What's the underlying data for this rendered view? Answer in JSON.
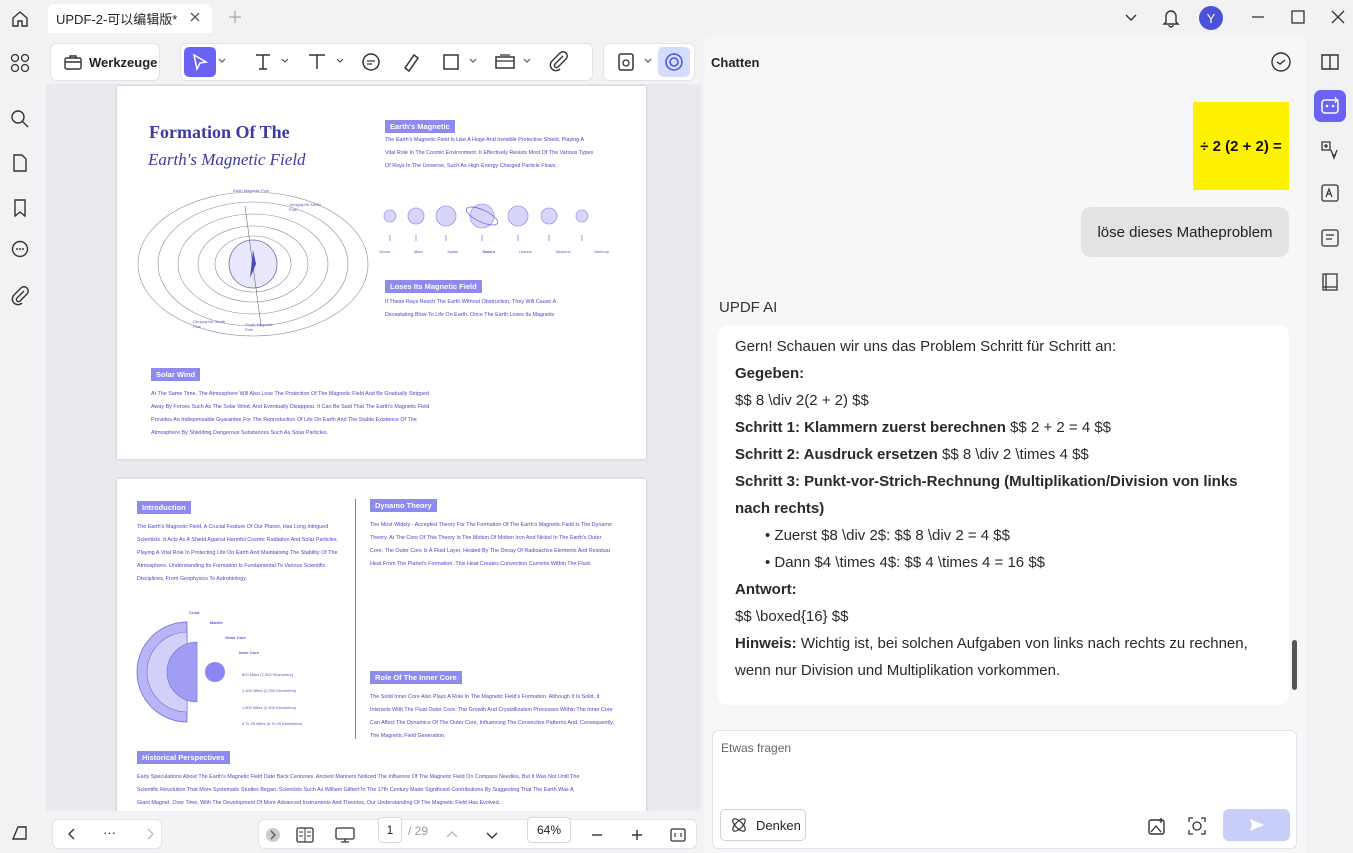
{
  "window": {
    "tab_title": "UPDF-2-可以编辑版*",
    "avatar_letter": "Y"
  },
  "toolbar": {
    "werkzeuge_label": "Werkzeuge"
  },
  "page1": {
    "title_line1": "Formation Of The",
    "title_line2": "Earth's Magnetic Field",
    "section1_label": "Earth's Magnetic",
    "section1_text": "The Earth's Magnetic Field Is Like A Huge And Invisible Protective Shield, Playing A Vital Role In The Cosmic Environment. It Effectively Resists Most Of The Various Types Of Rays In The Universe, Such As High-Energy Charged Particle Flows.",
    "planets": [
      "Venus",
      "Mars",
      "Jupiter",
      "Saturn",
      "Uranus",
      "Neptune",
      "Mercury"
    ],
    "section2_label": "Loses Its Magnetic Field",
    "section2_text": "If These Rays Reach The Earth Without Obstruction, They Will Cause A Devastating Blow To Life On Earth. Once The Earth Loses Its Magnetic",
    "section3_label": "Solar Wind",
    "section3_text": "At The Same Time, The Atmosphere Will Also Lose The Protection Of The Magnetic Field And Be Gradually Stripped Away By Forces Such As The Solar Wind, And Eventually Disappear. It Can Be Said That The Earth's Magnetic Field Provides An Indispensable Guarantee For The Reproduction Of Life On Earth And The Stable Existence Of The Atmosphere By Shielding Dangerous Substances Such As Solar Particles.",
    "diagram_labels": {
      "earth_mag_pole": "Earth Magnetic Pole",
      "geo_north": "Geographic North Pole",
      "geo_south": "Geographic South Pole",
      "south_mag": "South Magnetic Pole"
    }
  },
  "page2": {
    "intro_label": "Introduction",
    "intro_text": "The Earth's Magnetic Field, A Crucial Feature Of Our Planet, Has Long Intrigued Scientists. It Acts As A Shield Against Harmful Cosmic Radiation And Solar Particles, Playing A Vital Role In Protecting Life On Earth And Maintaining The Stability Of The Atmosphere. Understanding Its Formation Is Fundamental To Various Scientific Disciplines, From Geophysics To Astrobiology.",
    "dynamo_label": "Dynamo Theory",
    "dynamo_text": "The Most Widely - Accepted Theory For The Formation Of The Earth's Magnetic Field Is The Dynamo Theory. At The Core Of This Theory Is The Motion Of Molten Iron And Nickel In The Earth's Outer Core. The Outer Core Is A Fluid Layer, Heated By The Decay Of Radioactive Elements And Residual Heat From The Planet's Formation. This Heat Creates Convection Currents Within The Fluid.",
    "core_layers": [
      "Crust",
      "Mantle",
      "Outer Core",
      "Inner Core"
    ],
    "core_depths": [
      "800 Miles (1,300 Kilometers)",
      "1,400 Miles (2,250 Kilometers)",
      "1,800 Miles (2,900 Kilometers)",
      "5 To 25 Miles (8 To 40 Kilometers)"
    ],
    "inner_label": "Role Of The Inner Core",
    "inner_text": "The Solid Inner Core Also Plays A Role In The Magnetic Field's Formation. Although It Is Solid, It Interacts With The Fluid Outer Core. The Growth And Crystallization Processes Within The Inner Core Can Affect The Dynamics Of The Outer Core, Influencing The Convective Patterns And, Consequently, The Magnetic Field Generation.",
    "hist_label": "Historical Perspectives",
    "hist_text": "Early Speculations About The Earth's Magnetic Field Date Back Centuries. Ancient Mariners Noticed The Influence Of The Magnetic Field On Compass Needles, But It Was Not Until The Scientific Revolution That More Systematic Studies Began. Scientists Such As William Gilbert In The 17th Century Made Significant Contributions By Suggesting That The Earth Was A Giant Magnet. Over Time, With The Development Of More Advanced Instruments And Theories, Our Understanding Of The Magnetic Field Has Evolved."
  },
  "bottombar": {
    "current_page": "1",
    "total_pages": "/ 29",
    "zoom": "64%",
    "more": "···"
  },
  "chat": {
    "title": "Chatten",
    "image_content": "÷ 2 (2 + 2) =",
    "user_message": "löse dieses Matheproblem",
    "ai_name": "UPDF AI",
    "ai_lines": {
      "l1": "Gern! Schauen wir uns das Problem Schritt für Schritt an:",
      "l2": "Gegeben:",
      "l3": "$$ 8 \\div 2(2 + 2) $$",
      "l4b": "Schritt 1: Klammern zuerst berechnen",
      "l4": " $$ 2 + 2 = 4 $$",
      "l5b": "Schritt 2: Ausdruck ersetzen",
      "l5": " $$ 8 \\div 2 \\times 4 $$",
      "l6b": "Schritt 3: Punkt-vor-Strich-Rechnung (Multiplikation/Division von links nach rechts)",
      "l7": "Zuerst $8 \\div 2$: $$ 8 \\div 2 = 4 $$",
      "l8": "Dann $4 \\times 4$: $$ 4 \\times 4 = 16 $$",
      "l9": "Antwort:",
      "l10": "$$ \\boxed{16} $$",
      "l11b": "Hinweis:",
      "l11": " Wichtig ist, bei solchen Aufgaben von links nach rechts zu rechnen, wenn nur Division und Multiplikation vorkommen."
    },
    "input_placeholder": "Etwas fragen",
    "denken_label": "Denken"
  },
  "colors": {
    "accent": "#6a63f6",
    "doc_purple": "#4a48c8"
  }
}
